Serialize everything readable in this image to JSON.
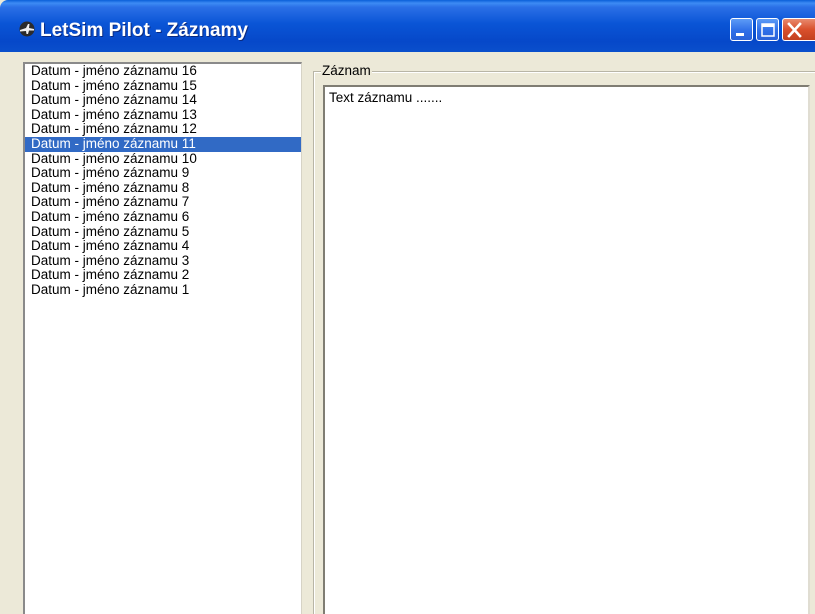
{
  "window": {
    "title": "LetSim Pilot - Záznamy",
    "icon": "app-plane-icon",
    "buttons": [
      "minimize-icon",
      "maximize-icon",
      "close-icon"
    ]
  },
  "records_list": {
    "items": [
      "Datum - jméno záznamu 16",
      "Datum - jméno záznamu 15",
      "Datum - jméno záznamu 14",
      "Datum - jméno záznamu 13",
      "Datum - jméno záznamu 12",
      "Datum - jméno záznamu 11",
      "Datum - jméno záznamu 10",
      "Datum - jméno záznamu 9",
      "Datum - jméno záznamu 8",
      "Datum - jméno záznamu 7",
      "Datum - jméno záznamu 6",
      "Datum - jméno záznamu 5",
      "Datum - jméno záznamu 4",
      "Datum - jméno záznamu 3",
      "Datum - jméno záznamu 2",
      "Datum - jméno záznamu 1"
    ],
    "selected_index": 5
  },
  "record_panel": {
    "legend": "Záznam",
    "text": "Text záznamu ......."
  },
  "colors": {
    "titlebar": "#0a55d6",
    "selection": "#316ac5",
    "window_bg": "#ece9d8",
    "close_button": "#d9502c"
  }
}
